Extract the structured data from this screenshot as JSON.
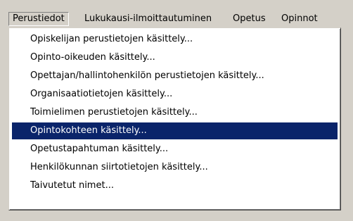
{
  "menubar": {
    "items": [
      {
        "label": "Perustiedot"
      },
      {
        "label": "Lukukausi-ilmoittautuminen"
      },
      {
        "label": "Opetus"
      },
      {
        "label": "Opinnot"
      }
    ]
  },
  "dropdown": {
    "selected_index": 5,
    "items": [
      {
        "label": "Opiskelijan perustietojen käsittely..."
      },
      {
        "label": "Opinto-oikeuden käsittely..."
      },
      {
        "label": "Opettajan/hallintohenkilön perustietojen käsittely..."
      },
      {
        "label": "Organisaatiotietojen käsittely..."
      },
      {
        "label": "Toimielimen perustietojen käsittely..."
      },
      {
        "label": "Opintokohteen käsittely..."
      },
      {
        "label": "Opetustapahtuman käsittely..."
      },
      {
        "label": "Henkilökunnan siirtotietojen käsittely..."
      },
      {
        "label": "Taivutetut nimet..."
      }
    ]
  },
  "colors": {
    "menu_bg": "#d4d0c8",
    "dropdown_bg": "#ffffff",
    "highlight": "#0a246a",
    "highlight_text": "#ffffff"
  }
}
